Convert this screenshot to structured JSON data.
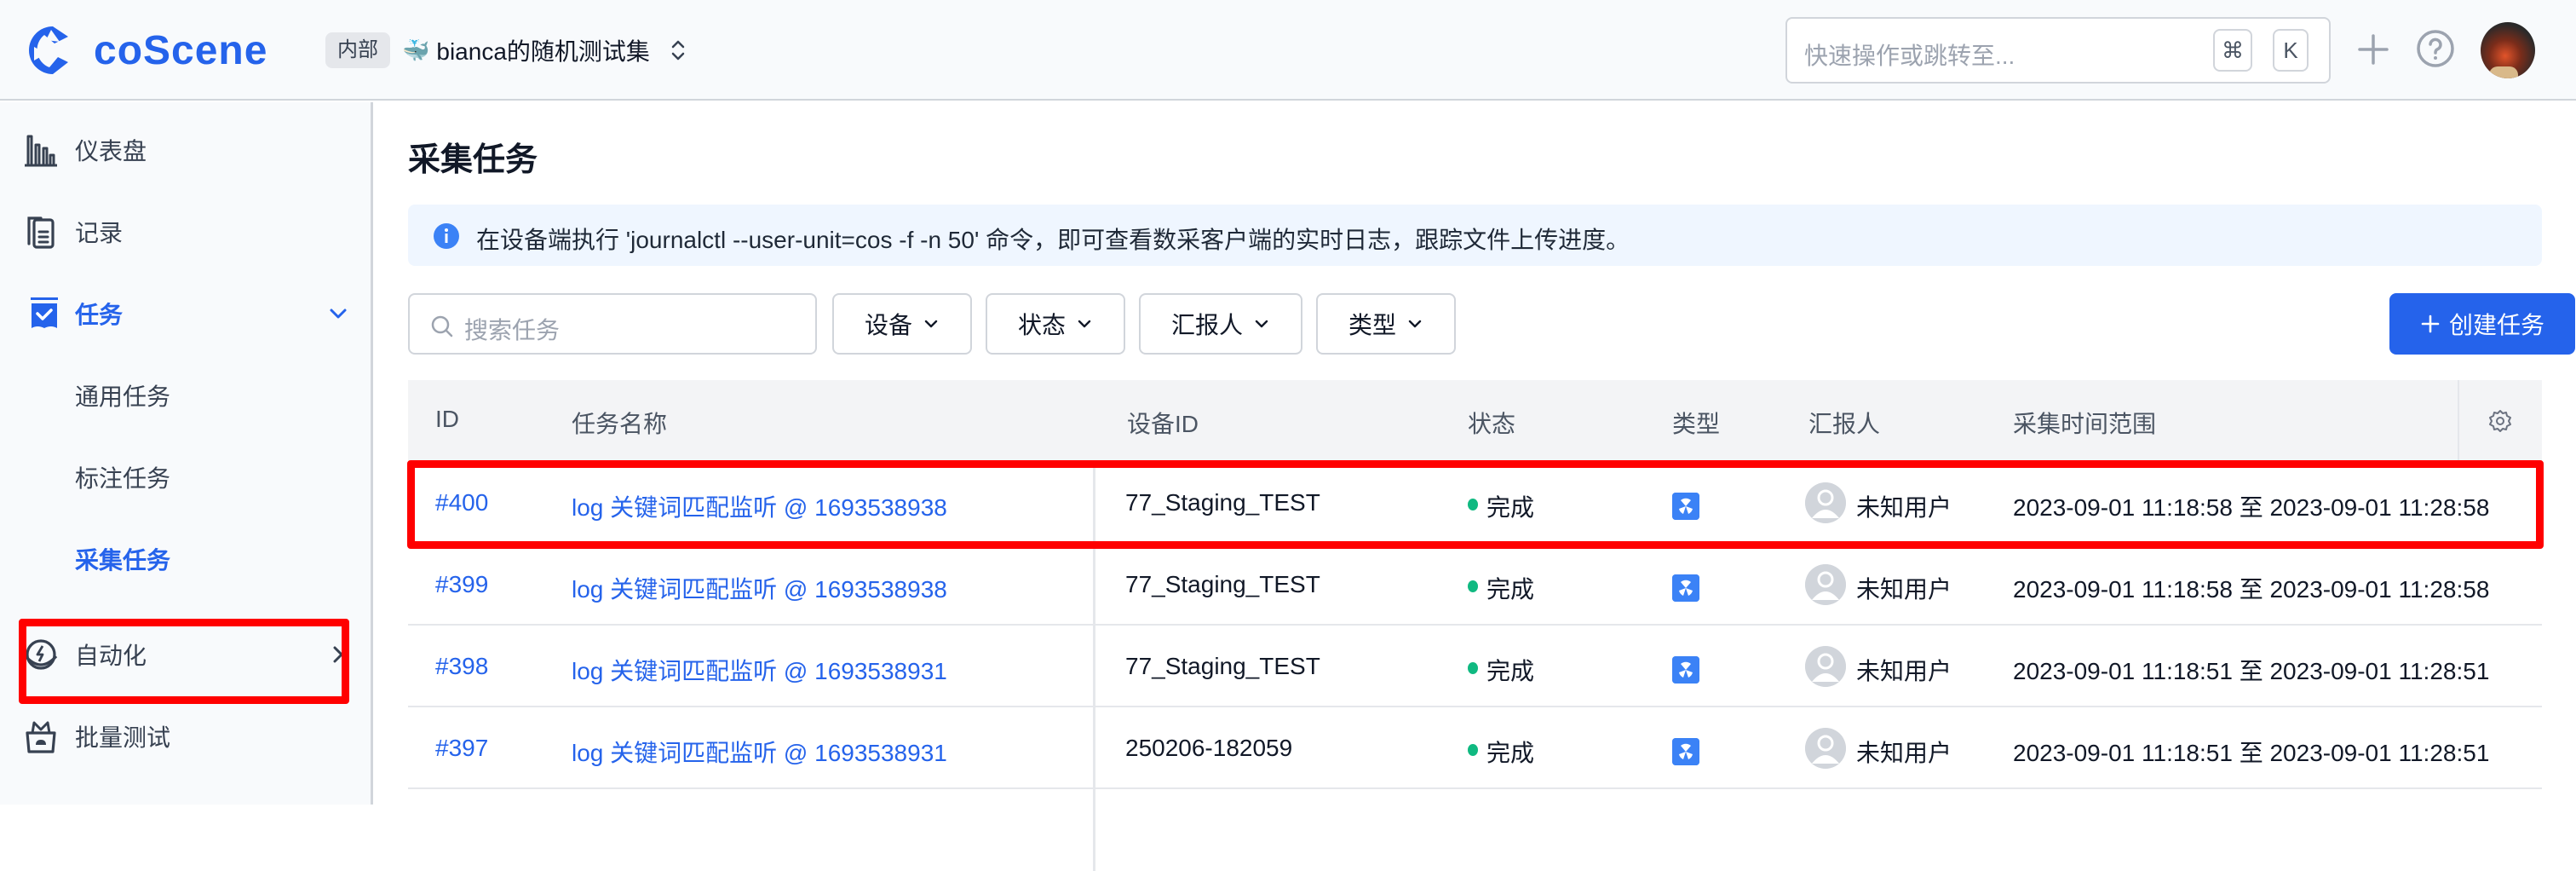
{
  "header": {
    "brand": "coScene",
    "org_badge": "内部",
    "project_emoji": "🐳",
    "project_name": "bianca的随机测试集",
    "quick_search_placeholder": "快速操作或跳转至...",
    "shortcut_keys": [
      "⌘",
      "K"
    ]
  },
  "sidebar": {
    "items": [
      {
        "label": "仪表盘",
        "icon": "bar-chart-icon"
      },
      {
        "label": "记录",
        "icon": "clipboard-icon"
      },
      {
        "label": "任务",
        "icon": "task-check-icon",
        "active": true,
        "expanded": true
      },
      {
        "label": "通用任务",
        "sub": true
      },
      {
        "label": "标注任务",
        "sub": true
      },
      {
        "label": "采集任务",
        "sub": true,
        "active": true
      },
      {
        "label": "自动化",
        "icon": "automation-icon",
        "collapsed": true
      },
      {
        "label": "批量测试",
        "icon": "batch-test-icon"
      }
    ]
  },
  "main": {
    "title": "采集任务",
    "info": "在设备端执行 'journalctl --user-unit=cos -f -n 50' 命令，即可查看数采客户端的实时日志，跟踪文件上传进度。",
    "search_placeholder": "搜索任务",
    "filters": [
      "设备",
      "状态",
      "汇报人",
      "类型"
    ],
    "create_button": "创建任务",
    "columns": [
      "ID",
      "任务名称",
      "设备ID",
      "状态",
      "类型",
      "汇报人",
      "采集时间范围"
    ],
    "rows": [
      {
        "id": "#400",
        "name": "log 关键词匹配监听 @ 1693538938",
        "device": "77_Staging_TEST",
        "status": "完成",
        "reporter": "未知用户",
        "range": "2023-09-01 11:18:58 至 2023-09-01 11:28:58"
      },
      {
        "id": "#399",
        "name": "log 关键词匹配监听 @ 1693538938",
        "device": "77_Staging_TEST",
        "status": "完成",
        "reporter": "未知用户",
        "range": "2023-09-01 11:18:58 至 2023-09-01 11:28:58"
      },
      {
        "id": "#398",
        "name": "log 关键词匹配监听 @ 1693538931",
        "device": "77_Staging_TEST",
        "status": "完成",
        "reporter": "未知用户",
        "range": "2023-09-01 11:18:51 至 2023-09-01 11:28:51"
      },
      {
        "id": "#397",
        "name": "log 关键词匹配监听 @ 1693538931",
        "device": "250206-182059",
        "status": "完成",
        "reporter": "未知用户",
        "range": "2023-09-01 11:18:51 至 2023-09-01 11:28:51"
      }
    ]
  },
  "colors": {
    "accent": "#2563eb",
    "status_done": "#10b981",
    "highlight": "#ff0000"
  }
}
